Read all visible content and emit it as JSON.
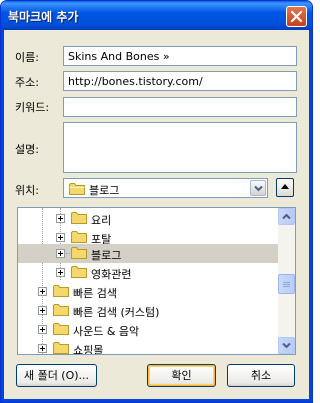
{
  "window": {
    "title": "북마크에 추가"
  },
  "form": {
    "name_label": "이름:",
    "name_value": "Skins And Bones »",
    "address_label": "주소:",
    "address_value": "http://bones.tistory.com/",
    "keyword_label": "키워드:",
    "keyword_value": "",
    "description_label": "설명:",
    "description_value": "",
    "location_label": "위치:",
    "location_value": "블로그"
  },
  "tree": {
    "items": [
      {
        "label": "요리",
        "level": 2,
        "selected": false
      },
      {
        "label": "포탈",
        "level": 2,
        "selected": false
      },
      {
        "label": "블로그",
        "level": 2,
        "selected": true
      },
      {
        "label": "영화관련",
        "level": 2,
        "selected": false
      },
      {
        "label": "빠른 검색",
        "level": 1,
        "selected": false
      },
      {
        "label": "빠른 검색 (커스텀)",
        "level": 1,
        "selected": false
      },
      {
        "label": "사운드 & 음악",
        "level": 1,
        "selected": false
      },
      {
        "label": "쇼핑몰",
        "level": 1,
        "selected": false
      }
    ]
  },
  "buttons": {
    "new_folder": "새 폴더 (O)...",
    "ok": "확인",
    "cancel": "취소"
  },
  "colors": {
    "titlebar": "#0055e5",
    "dialog_bg": "#ece9d8",
    "folder": "#f5d86b",
    "close_button": "#d4532e"
  },
  "icons": {
    "close": "close-icon",
    "folder": "folder-icon",
    "dropdown": "chevron-down-icon",
    "expand": "chevron-up-icon"
  }
}
